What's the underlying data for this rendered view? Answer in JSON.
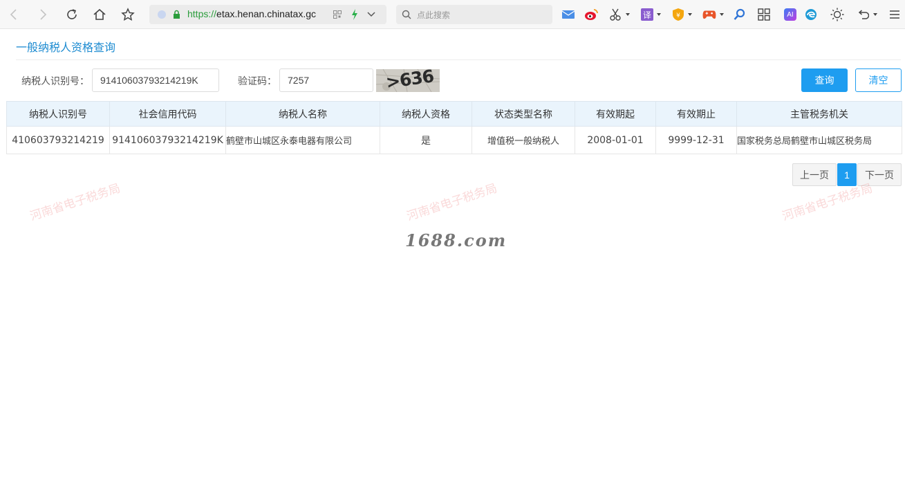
{
  "browser": {
    "url_scheme": "https://",
    "url_host": "etax.henan.chinatax.gc",
    "search_placeholder": "点此搜索",
    "translate_label": "译",
    "ai_label": "AI"
  },
  "page": {
    "title": "一般纳税人资格查询"
  },
  "form": {
    "taxpayer_id_label": "纳税人识别号：",
    "taxpayer_id_value": "91410603793214219K",
    "captcha_label": "验证码：",
    "captcha_value": "7257",
    "captcha_image_text": ">636",
    "query_label": "查询",
    "clear_label": "清空"
  },
  "table": {
    "headers": [
      "纳税人识别号",
      "社会信用代码",
      "纳税人名称",
      "纳税人资格",
      "状态类型名称",
      "有效期起",
      "有效期止",
      "主管税务机关"
    ],
    "rows": [
      [
        "410603793214219",
        "91410603793214219K",
        "鹤壁市山城区永泰电器有限公司",
        "是",
        "增值税一般纳税人",
        "2008-01-01",
        "9999-12-31",
        "国家税务总局鹤壁市山城区税务局"
      ]
    ]
  },
  "pagination": {
    "prev_label": "上一页",
    "current_page": "1",
    "next_label": "下一页"
  },
  "watermarks": {
    "text": "河南省电子税务局",
    "site": "1688.com"
  },
  "colors": {
    "accent": "#1e9df0",
    "header_bg": "#eaf4fc",
    "title": "#1d8bd1"
  }
}
